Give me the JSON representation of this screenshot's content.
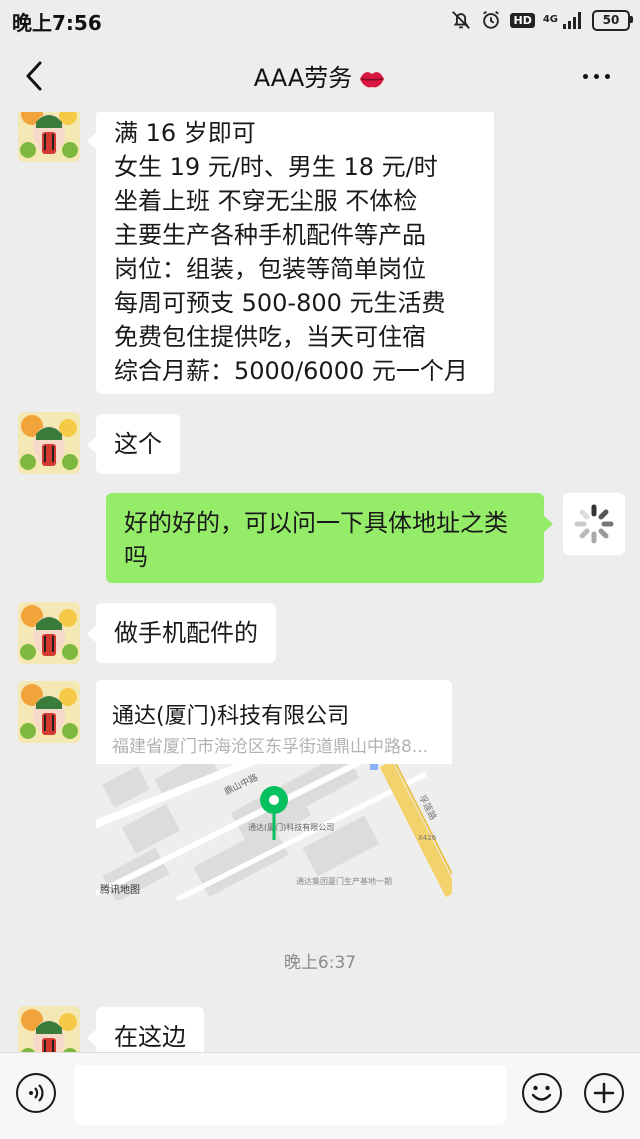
{
  "status_bar": {
    "time": "晚上7:56",
    "network_label": "4G",
    "hd_label": "HD",
    "battery": "50",
    "icons": [
      "bell-off-icon",
      "alarm-icon",
      "hd-icon",
      "signal-icon",
      "battery-icon"
    ]
  },
  "header": {
    "title": "AAA劳务",
    "title_emoji": "lips-icon",
    "back_icon": "chevron-left-icon",
    "more_icon": "more-icon"
  },
  "messages": [
    {
      "sender": "contact",
      "lines": [
        "满 16 岁即可",
        "女生 19 元/时、男生 18 元/时",
        "坐着上班 不穿无尘服 不体检",
        "主要生产各种手机配件等产品",
        "岗位：组装，包装等简单岗位",
        "每周可预支 500-800 元生活费",
        "免费包住提供吃，当天可住宿",
        "综合月薪：5000/6000 元一个月"
      ]
    },
    {
      "sender": "contact",
      "text": "这个"
    },
    {
      "sender": "me",
      "lines": [
        "好的好的，可以问一下具体地址之类",
        "吗"
      ],
      "status": "sending"
    },
    {
      "sender": "contact",
      "text": "做手机配件的"
    },
    {
      "sender": "contact",
      "type": "location",
      "name": "通达(厦门)科技有限公司",
      "address": "福建省厦门市海沧区东孚街道鼎山中路8...",
      "map": {
        "road_1": "鼎山中路",
        "road_2": "孚莲路",
        "road_3": "X426",
        "poi_1": "通达(厦门)科技有限公司",
        "poi_2": "通达集团厦门生产基地一期",
        "provider": "腾讯地图"
      }
    },
    {
      "type": "timestamp",
      "text": "晚上6:37"
    },
    {
      "sender": "contact",
      "text": "在这边"
    }
  ],
  "input_bar": {
    "placeholder": "",
    "voice_icon": "voice-icon",
    "emoji_icon": "emoji-icon",
    "plus_icon": "plus-icon"
  },
  "colors": {
    "background": "#ededed",
    "my_bubble": "#95ec69",
    "their_bubble": "#ffffff",
    "map_pin": "#07c160"
  }
}
